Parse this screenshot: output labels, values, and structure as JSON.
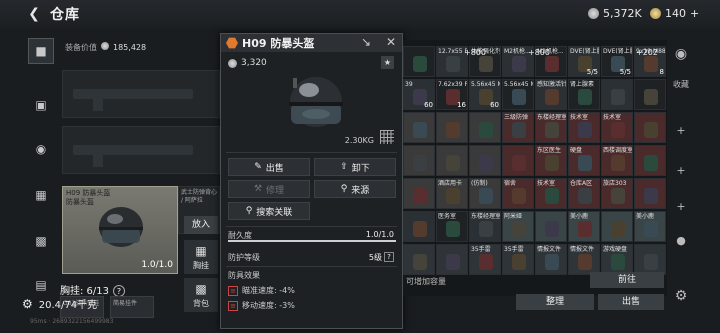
{
  "header": {
    "back_icon": "back-arrow-icon",
    "title": "仓库",
    "silver": "5,372K",
    "gold": "140",
    "gold_plus": "+"
  },
  "equipment": {
    "value_label": "装备价值",
    "value": "185,428",
    "helmet_slot": {
      "label": "H09 防暴头盔",
      "sub": "防暴头盔",
      "durability": "1.0/1.0"
    },
    "vest_slot_label": "武士防弹背心 / 阿萨拉",
    "chest_label": "胸挂: 6/13",
    "chest_items": [
      "G01战术弹挂",
      "简易挂件"
    ],
    "weight": "20.4/74千克"
  },
  "actions": {
    "put_in": "放入",
    "chest_button": "胸挂",
    "backpack_button": "背包"
  },
  "item_panel": {
    "name": "H09 防暴头盔",
    "price": "3,320",
    "weight": "2.30KG",
    "sell": "出售",
    "unequip": "卸下",
    "repair": "修理",
    "source": "来源",
    "search_related": "搜索关联",
    "durability_label": "耐久度",
    "durability_value": "1.0/1.0",
    "durability_fraction": 1.0,
    "protection_label": "防护等级",
    "protection_value": "5级",
    "protection_help": "?",
    "effects_label": "防具效果",
    "effects": [
      {
        "label": "瞄准速度: -4%"
      },
      {
        "label": "移动速度: -3%"
      }
    ]
  },
  "stash": {
    "top_counts": [
      "+800",
      "+800",
      "+202"
    ],
    "rows": [
      [
        {
          "label": "",
          "count": ""
        },
        {
          "label": "12.7x55 PS12...",
          "count": ""
        },
        {
          "label": "体能强化剂",
          "count": ""
        },
        {
          "label": "M2机枪...",
          "count": ""
        },
        {
          "label": "M2机枪...",
          "count": ""
        },
        {
          "label": "DVE(肾上腺素)",
          "count": "5/5"
        },
        {
          "label": "DVE(肾上腺素)",
          "count": "5/5"
        },
        {
          "label": "9x19 M882",
          "count": "8"
        }
      ],
      [
        {
          "label": "39",
          "count": "60"
        },
        {
          "label": "7.62x39 PS",
          "count": "16"
        },
        {
          "label": "5.56x45 M855",
          "count": "60"
        },
        {
          "label": "5.56x45 M855A1",
          "count": ""
        },
        {
          "label": "感知激活针",
          "count": ""
        },
        {
          "label": "肾上腺素",
          "count": ""
        },
        {
          "label": "",
          "count": ""
        },
        {
          "label": "",
          "count": ""
        }
      ],
      [
        {
          "label": "",
          "count": ""
        },
        {
          "label": "",
          "count": ""
        },
        {
          "label": "",
          "count": ""
        },
        {
          "label": "三级防弹",
          "count": ""
        },
        {
          "label": "东楼经理室",
          "count": ""
        },
        {
          "label": "技术室",
          "count": ""
        },
        {
          "label": "技术室",
          "count": ""
        },
        {
          "label": "",
          "count": ""
        }
      ],
      [
        {
          "label": "",
          "count": ""
        },
        {
          "label": "",
          "count": ""
        },
        {
          "label": "",
          "count": ""
        },
        {
          "label": "",
          "count": ""
        },
        {
          "label": "东区医生",
          "count": ""
        },
        {
          "label": "硬盘",
          "count": ""
        },
        {
          "label": "西楼调度室",
          "count": ""
        },
        {
          "label": "",
          "count": ""
        }
      ],
      [
        {
          "label": "",
          "count": ""
        },
        {
          "label": "酒店用卡",
          "count": ""
        },
        {
          "label": "(仿制)",
          "count": ""
        },
        {
          "label": "宿舍",
          "count": ""
        },
        {
          "label": "技术室",
          "count": ""
        },
        {
          "label": "仓库A区",
          "count": ""
        },
        {
          "label": "旅店303",
          "count": ""
        },
        {
          "label": "",
          "count": ""
        }
      ],
      [
        {
          "label": "",
          "count": ""
        },
        {
          "label": "医务室",
          "count": ""
        },
        {
          "label": "东楼经理室",
          "count": ""
        },
        {
          "label": "阿米娅",
          "count": ""
        },
        {
          "label": "",
          "count": ""
        },
        {
          "label": "美小鹿",
          "count": ""
        },
        {
          "label": "",
          "count": ""
        },
        {
          "label": "美小鹿",
          "count": ""
        }
      ],
      [
        {
          "label": "",
          "count": ""
        },
        {
          "label": "",
          "count": ""
        },
        {
          "label": "35手雷",
          "count": ""
        },
        {
          "label": "35手雷",
          "count": ""
        },
        {
          "label": "情报文件",
          "count": ""
        },
        {
          "label": "情报文件",
          "count": ""
        },
        {
          "label": "游戏硬盘",
          "count": ""
        },
        {
          "label": "",
          "count": ""
        }
      ]
    ],
    "capacity_text": "可增加容量",
    "goto": "前往",
    "organize": "整理",
    "sell": "出售"
  },
  "right_nav": {
    "label": "收藏",
    "icons": [
      "helmet-icon",
      "plus-icon",
      "plus-icon",
      "plus-icon",
      "plus-icon",
      "lock-icon",
      "gear-icon"
    ]
  },
  "status_bar": "95ms · 2689322156499983"
}
